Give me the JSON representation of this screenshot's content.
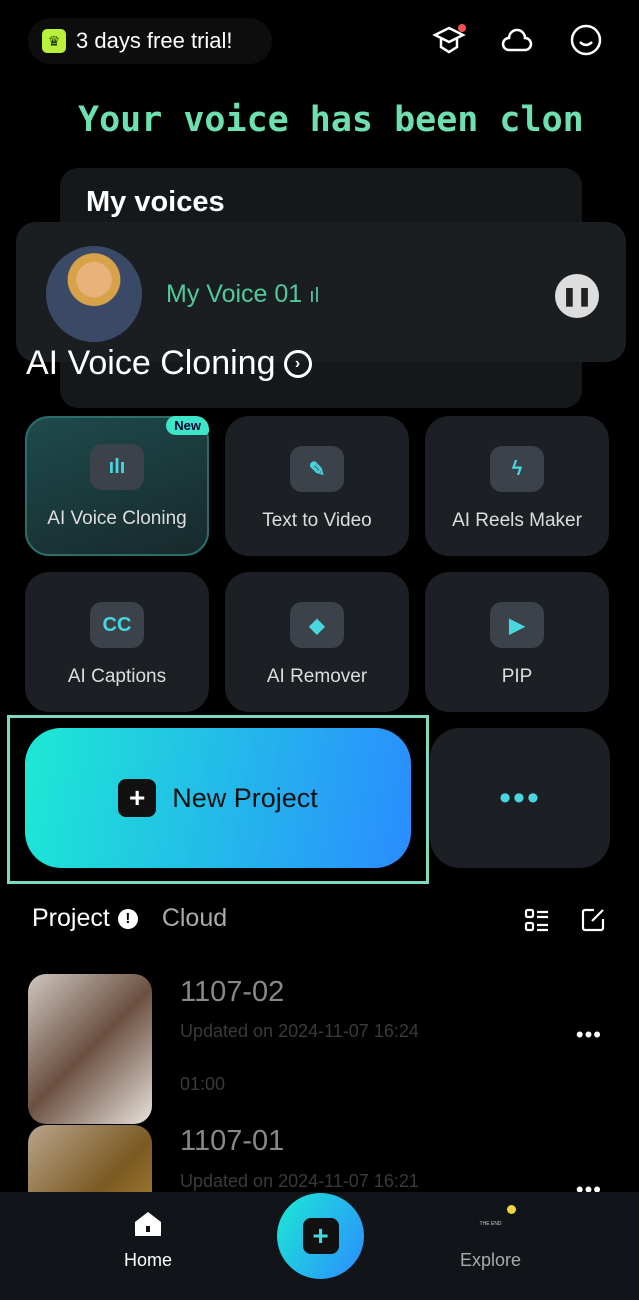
{
  "header": {
    "trial_label": "3 days free trial!",
    "icons": [
      "graduation-cap-icon",
      "cloud-icon",
      "profile-smile-icon"
    ]
  },
  "banner": {
    "text": "Your voice has been clon"
  },
  "voices": {
    "title": "My voices",
    "current": "My Voice 01",
    "level_glyph": "ıl"
  },
  "feature": {
    "title": "AI Voice Cloning"
  },
  "tools": [
    {
      "label": "AI Voice Cloning",
      "badge": "New",
      "glyph": "ılı"
    },
    {
      "label": "Text  to Video",
      "glyph": "✎"
    },
    {
      "label": "AI Reels Maker",
      "glyph": "ϟ"
    },
    {
      "label": "AI Captions",
      "glyph": "CC"
    },
    {
      "label": "AI Remover",
      "glyph": "◆"
    },
    {
      "label": "PIP",
      "glyph": "▶"
    }
  ],
  "new_project": {
    "label": "New Project",
    "plus": "+"
  },
  "more": {
    "label": "•••"
  },
  "tabs": {
    "project": "Project",
    "cloud": "Cloud",
    "warn": "!"
  },
  "projects": [
    {
      "title": "1107-02",
      "updated": "Updated on 2024-11-07 16:24",
      "duration": "01:00"
    },
    {
      "title": "1107-01",
      "updated": "Updated on 2024-11-07 16:21"
    }
  ],
  "nav": {
    "home": "Home",
    "explore": "Explore",
    "explore_thumb": "THE END"
  },
  "colors": {
    "accent": "#48d6e0",
    "banner": "#6ee0b0",
    "gradient_start": "#1de9d4",
    "gradient_end": "#2a8cff"
  }
}
